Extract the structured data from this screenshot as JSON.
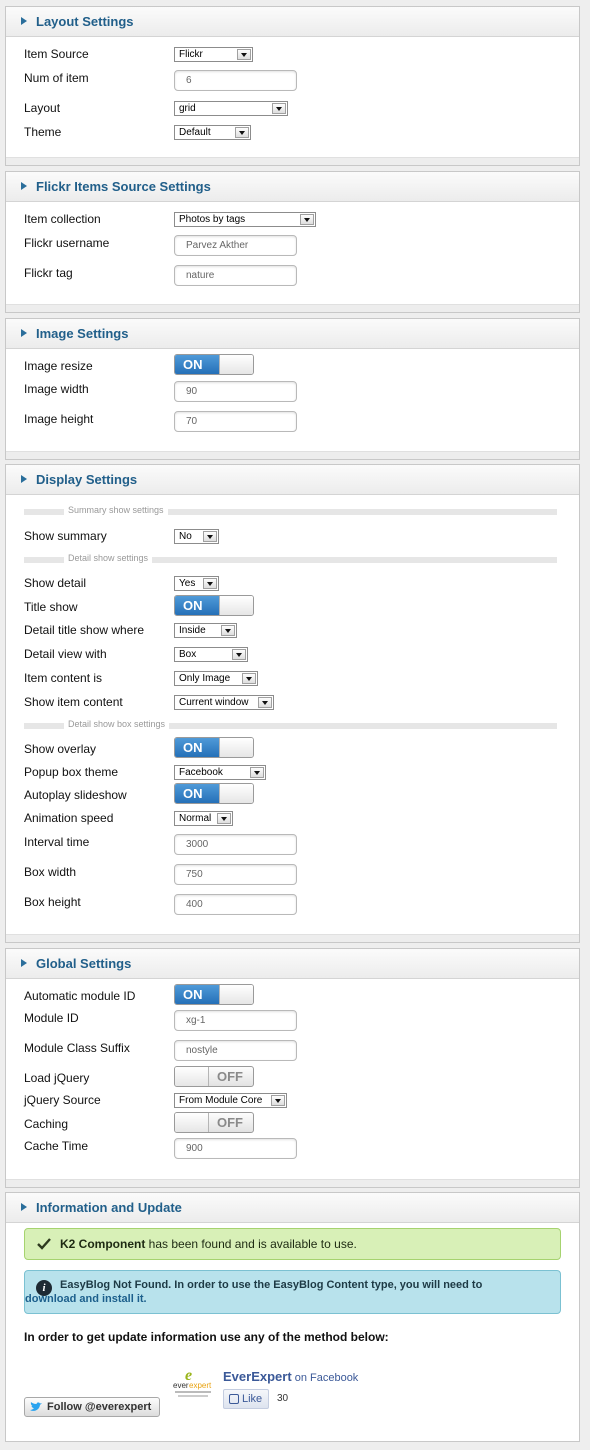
{
  "layout": {
    "title": "Layout Settings",
    "item_source_label": "Item Source",
    "item_source_value": "Flickr",
    "num_item_label": "Num of item",
    "num_item_value": "6",
    "layout_label": "Layout",
    "layout_value": "grid",
    "theme_label": "Theme",
    "theme_value": "Default"
  },
  "flickr": {
    "title": "Flickr Items Source Settings",
    "collection_label": "Item collection",
    "collection_value": "Photos by tags",
    "username_label": "Flickr username",
    "username_value": "Parvez Akther",
    "tag_label": "Flickr tag",
    "tag_value": "nature"
  },
  "image": {
    "title": "Image Settings",
    "resize_label": "Image resize",
    "resize_state": "ON",
    "width_label": "Image width",
    "width_value": "90",
    "height_label": "Image height",
    "height_value": "70"
  },
  "display": {
    "title": "Display Settings",
    "summary_header": "Summary show settings",
    "show_summary_label": "Show summary",
    "show_summary_value": "No",
    "detail_header": "Detail show settings",
    "show_detail_label": "Show detail",
    "show_detail_value": "Yes",
    "title_show_label": "Title show",
    "title_show_state": "ON",
    "title_where_label": "Detail title show where",
    "title_where_value": "Inside",
    "view_with_label": "Detail view with",
    "view_with_value": "Box",
    "content_is_label": "Item content is",
    "content_is_value": "Only Image",
    "show_content_label": "Show item content",
    "show_content_value": "Current window",
    "box_header": "Detail show box settings",
    "overlay_label": "Show overlay",
    "overlay_state": "ON",
    "popup_theme_label": "Popup box theme",
    "popup_theme_value": "Facebook",
    "autoplay_label": "Autoplay slideshow",
    "autoplay_state": "ON",
    "anim_speed_label": "Animation speed",
    "anim_speed_value": "Normal",
    "interval_label": "Interval time",
    "interval_value": "3000",
    "box_width_label": "Box width",
    "box_width_value": "750",
    "box_height_label": "Box height",
    "box_height_value": "400"
  },
  "global": {
    "title": "Global Settings",
    "auto_id_label": "Automatic module ID",
    "auto_id_state": "ON",
    "module_id_label": "Module ID",
    "module_id_value": "xg-1",
    "class_suffix_label": "Module Class Suffix",
    "class_suffix_value": "nostyle",
    "load_jquery_label": "Load jQuery",
    "load_jquery_state": "OFF",
    "jquery_source_label": "jQuery Source",
    "jquery_source_value": "From Module Core",
    "caching_label": "Caching",
    "caching_state": "OFF",
    "cache_time_label": "Cache Time",
    "cache_time_value": "900"
  },
  "info": {
    "title": "Information and Update",
    "k2_strong": "K2 Component",
    "k2_rest": " has been found and is available to use.",
    "easyblog_text": "EasyBlog Not Found. In order to use the EasyBlog Content type, you will need to",
    "easyblog_link": "download and install it.",
    "update_text": "In order to get update information use any of the method below:",
    "fb_name": "EverExpert",
    "fb_on": " on Facebook",
    "like_label": "Like",
    "like_count": "30",
    "follow_label": "Follow @everexpert"
  },
  "colors": {
    "accent": "#215f8a",
    "toggle_on": "#2570b8",
    "success_bg": "#d8f0b7",
    "info_bg": "#b8e2ec"
  }
}
